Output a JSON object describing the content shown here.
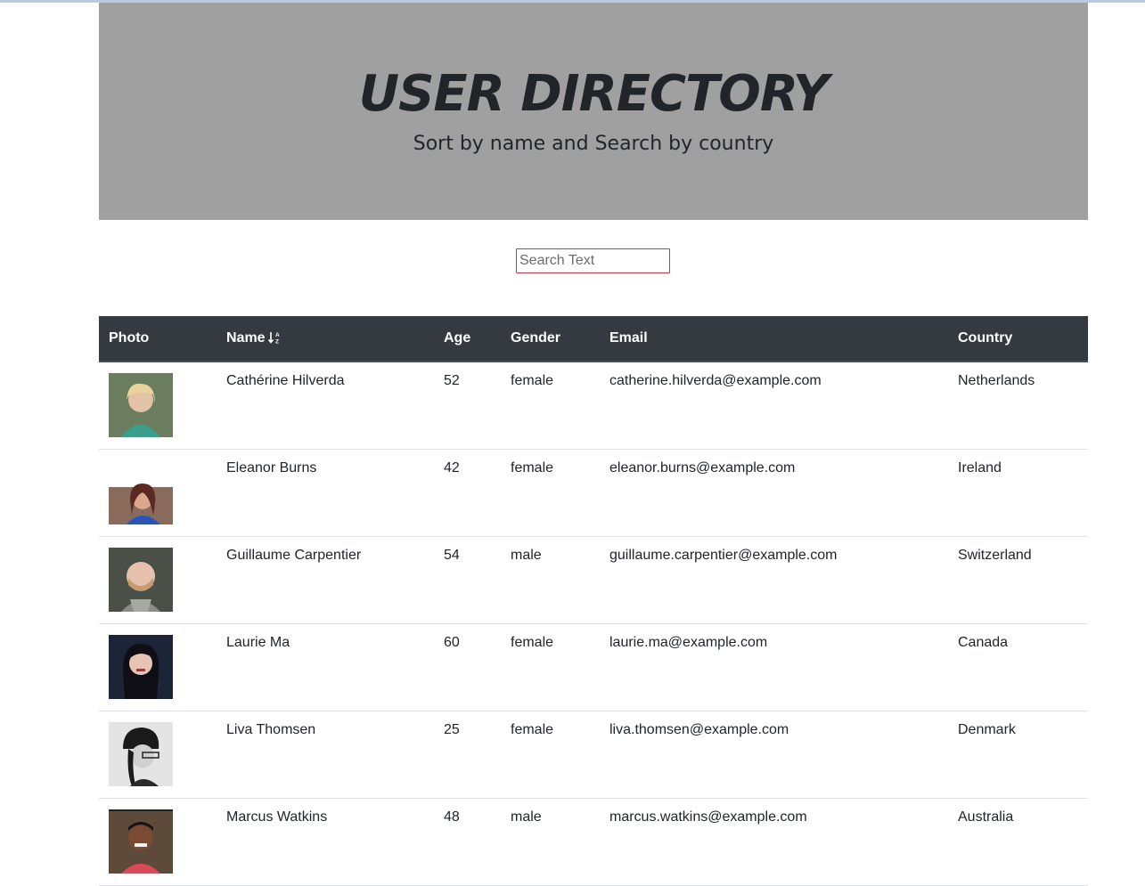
{
  "header": {
    "title": "USER DIRECTORY",
    "subtitle": "Sort by name and Search by country"
  },
  "search": {
    "placeholder": "Search Text",
    "value": ""
  },
  "table": {
    "columns": {
      "photo": "Photo",
      "name": "Name",
      "age": "Age",
      "gender": "Gender",
      "email": "Email",
      "country": "Country"
    },
    "sort_icon": "sort-alpha-down-icon",
    "rows": [
      {
        "name": "Cathérine Hilverda",
        "age": "52",
        "gender": "female",
        "email": "catherine.hilverda@example.com",
        "country": "Netherlands",
        "photo": "#6a7d5e"
      },
      {
        "name": "Eleanor Burns",
        "age": "42",
        "gender": "female",
        "email": "eleanor.burns@example.com",
        "country": "Ireland",
        "photo": "#8a6a5a"
      },
      {
        "name": "Guillaume Carpentier",
        "age": "54",
        "gender": "male",
        "email": "guillaume.carpentier@example.com",
        "country": "Switzerland",
        "photo": "#4a5048"
      },
      {
        "name": "Laurie Ma",
        "age": "60",
        "gender": "female",
        "email": "laurie.ma@example.com",
        "country": "Canada",
        "photo": "#1c2438"
      },
      {
        "name": "Liva Thomsen",
        "age": "25",
        "gender": "female",
        "email": "liva.thomsen@example.com",
        "country": "Denmark",
        "photo": "#9a9a9a"
      },
      {
        "name": "Marcus Watkins",
        "age": "48",
        "gender": "male",
        "email": "marcus.watkins@example.com",
        "country": "Australia",
        "photo": "#5e4a3a"
      }
    ]
  }
}
